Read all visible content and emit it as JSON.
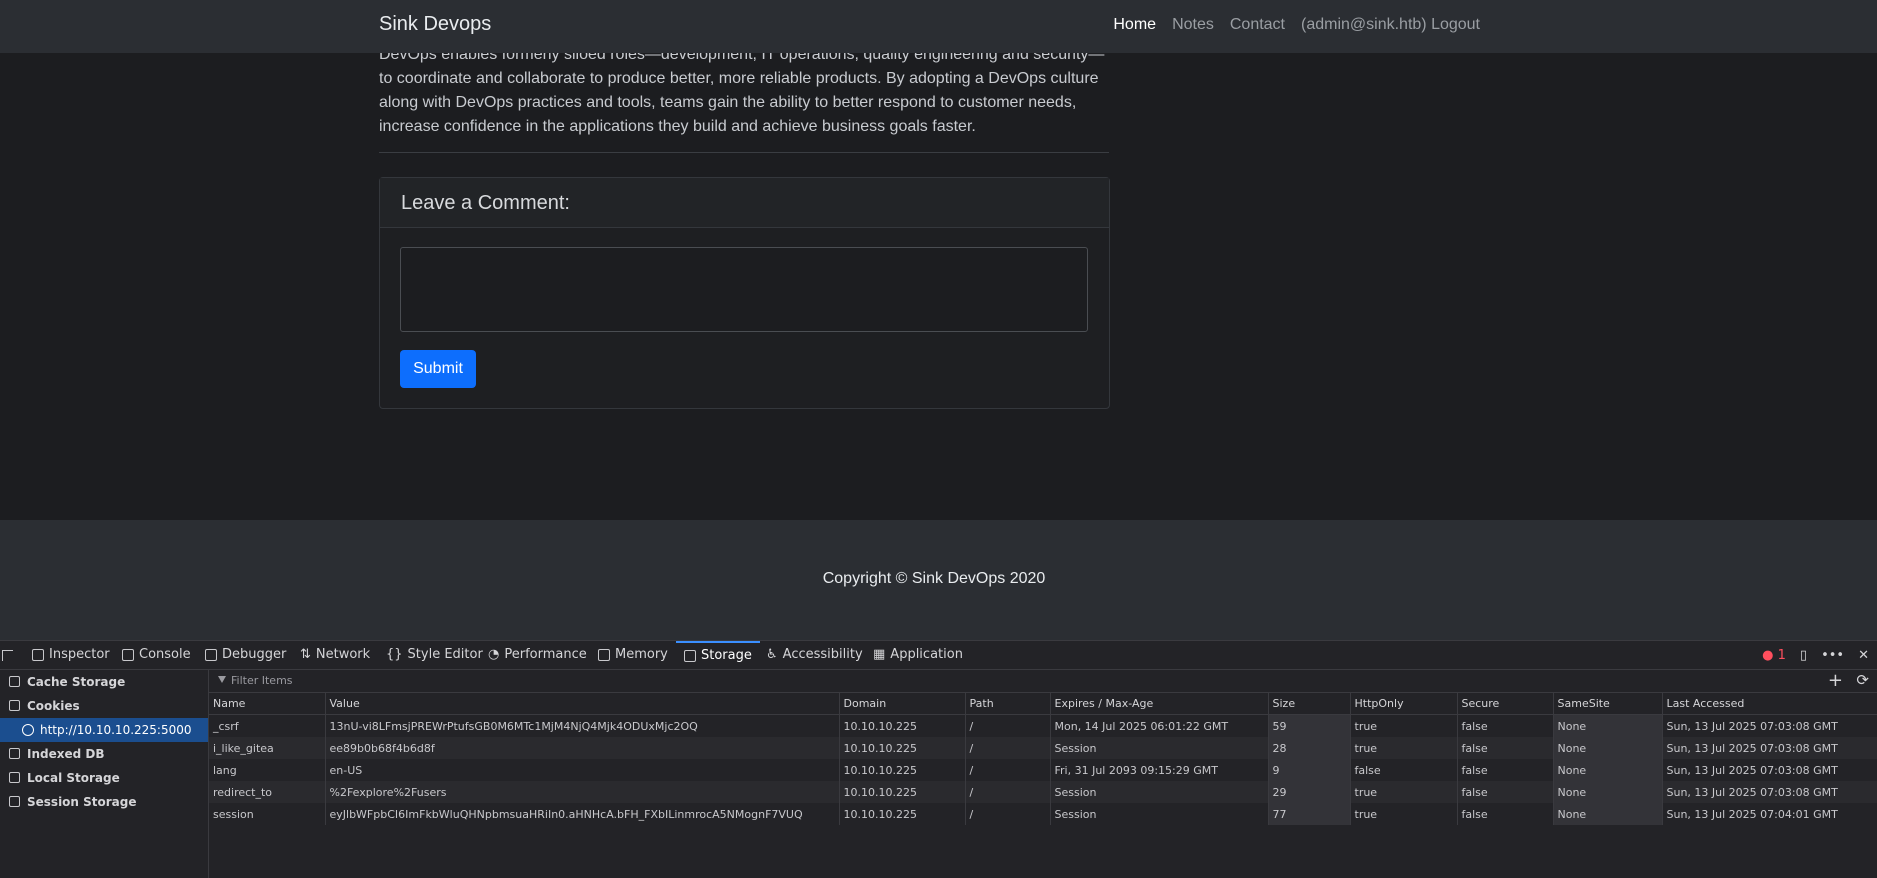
{
  "navbar": {
    "brand": "Sink Devops",
    "links": [
      "Home",
      "Notes",
      "Contact",
      "(admin@sink.htb) Logout"
    ]
  },
  "article": {
    "text": "DevOps enables formerly siloed roles—development, IT operations, quality engineering and security—to coordinate and collaborate to produce better, more reliable products. By adopting a DevOps culture along with DevOps practices and tools, teams gain the ability to better respond to customer needs, increase confidence in the applications they build and achieve business goals faster."
  },
  "comment": {
    "heading": "Leave a Comment:",
    "textarea_value": "",
    "submit_label": "Submit"
  },
  "footer": {
    "copyright": "Copyright © Sink DevOps 2020"
  },
  "devtools": {
    "tabs": [
      "Inspector",
      "Console",
      "Debugger",
      "Network",
      "Style Editor",
      "Performance",
      "Memory",
      "Storage",
      "Accessibility",
      "Application"
    ],
    "active_tab": "Storage",
    "error_count": "1",
    "sidebar": [
      "Cache Storage",
      "Cookies",
      "http://10.10.10.225:5000",
      "Indexed DB",
      "Local Storage",
      "Session Storage"
    ],
    "filter_placeholder": "Filter Items",
    "columns": [
      "Name",
      "Value",
      "Domain",
      "Path",
      "Expires / Max-Age",
      "Size",
      "HttpOnly",
      "Secure",
      "SameSite",
      "Last Accessed"
    ],
    "rows": [
      [
        "_csrf",
        "13nU-vi8LFmsjPREWrPtufsGB0M6MTc1MjM4NjQ4Mjk4ODUxMjc2OQ",
        "10.10.10.225",
        "/",
        "Mon, 14 Jul 2025 06:01:22 GMT",
        "59",
        "true",
        "false",
        "None",
        "Sun, 13 Jul 2025 07:03:08 GMT"
      ],
      [
        "i_like_gitea",
        "ee89b0b68f4b6d8f",
        "10.10.10.225",
        "/",
        "Session",
        "28",
        "true",
        "false",
        "None",
        "Sun, 13 Jul 2025 07:03:08 GMT"
      ],
      [
        "lang",
        "en-US",
        "10.10.10.225",
        "/",
        "Fri, 31 Jul 2093 09:15:29 GMT",
        "9",
        "false",
        "false",
        "None",
        "Sun, 13 Jul 2025 07:03:08 GMT"
      ],
      [
        "redirect_to",
        "%2Fexplore%2Fusers",
        "10.10.10.225",
        "/",
        "Session",
        "29",
        "true",
        "false",
        "None",
        "Sun, 13 Jul 2025 07:03:08 GMT"
      ],
      [
        "session",
        "eyJlbWFpbCI6ImFkbWluQHNpbmsuaHRiIn0.aHNHcA.bFH_FXbILinmrocA5NMognF7VUQ",
        "10.10.10.225",
        "/",
        "Session",
        "77",
        "true",
        "false",
        "None",
        "Sun, 13 Jul 2025 07:04:01 GMT"
      ]
    ]
  }
}
